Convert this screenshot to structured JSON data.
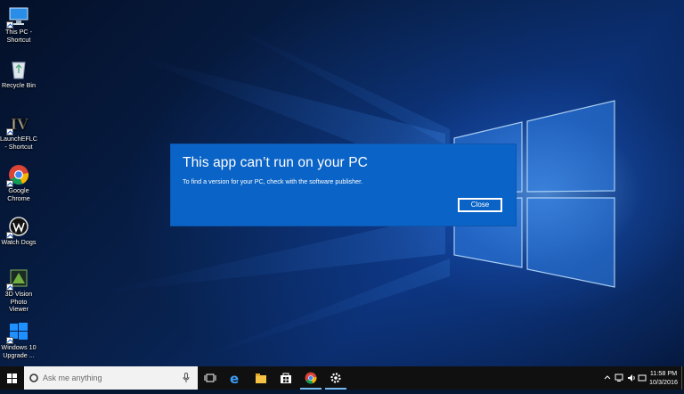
{
  "desktop": {
    "icons": [
      {
        "label": "This PC -\nShortcut",
        "icon": "computer-icon"
      },
      {
        "label": "Recycle Bin",
        "icon": "recycle-bin-icon"
      },
      {
        "label": "LaunchEFLC\n- Shortcut",
        "icon": "gta-iv-icon"
      },
      {
        "label": "Google\nChrome",
        "icon": "chrome-icon"
      },
      {
        "label": "Watch Dogs",
        "icon": "watch-dogs-icon"
      },
      {
        "label": "3D Vision\nPhoto Viewer",
        "icon": "3d-vision-icon"
      },
      {
        "label": "Windows 10\nUpgrade ...",
        "icon": "windows-upgrade-icon"
      }
    ]
  },
  "dialog": {
    "title": "This app can’t run on your PC",
    "message": "To find a version for your PC, check with the software publisher.",
    "close_label": "Close",
    "background": "#0a63c6"
  },
  "taskbar": {
    "search_placeholder": "Ask me anything",
    "pinned": [
      "task-view-icon",
      "edge-icon",
      "file-explorer-icon",
      "store-icon",
      "chrome-icon",
      "settings-icon"
    ],
    "clock_time": "11:58 PM",
    "clock_date": "10/3/2016"
  },
  "colors": {
    "accent": "#0a63c6",
    "taskbar": "#101010",
    "search_box": "#f2f2f2"
  }
}
